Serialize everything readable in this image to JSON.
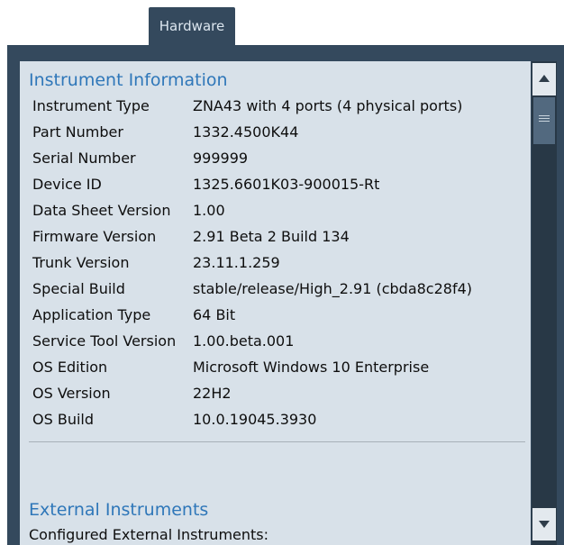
{
  "tab": {
    "label": "Hardware"
  },
  "instrument_info": {
    "title": "Instrument Information",
    "rows": [
      {
        "label": "Instrument Type",
        "value": "ZNA43 with 4 ports (4 physical ports)"
      },
      {
        "label": "Part Number",
        "value": "1332.4500K44"
      },
      {
        "label": "Serial Number",
        "value": "999999"
      },
      {
        "label": "Device ID",
        "value": "1325.6601K03-900015-Rt"
      },
      {
        "label": "Data Sheet Version",
        "value": "1.00"
      },
      {
        "label": "Firmware Version",
        "value": "2.91 Beta 2 Build 134"
      },
      {
        "label": "Trunk Version",
        "value": "23.11.1.259"
      },
      {
        "label": "Special Build",
        "value": "stable/release/High_2.91 (cbda8c28f4)"
      },
      {
        "label": "Application Type",
        "value": "64 Bit"
      },
      {
        "label": "Service Tool Version",
        "value": "1.00.beta.001"
      },
      {
        "label": "OS Edition",
        "value": "Microsoft Windows 10 Enterprise"
      },
      {
        "label": "OS Version",
        "value": "22H2"
      },
      {
        "label": "OS Build",
        "value": "10.0.19045.3930"
      }
    ]
  },
  "external": {
    "title": "External Instruments",
    "subtitle": "Configured External Instruments:"
  },
  "scrollbar": {
    "up_icon": "arrow-up-icon",
    "down_icon": "arrow-down-icon",
    "thumb_icon": "grip-lines-icon"
  }
}
